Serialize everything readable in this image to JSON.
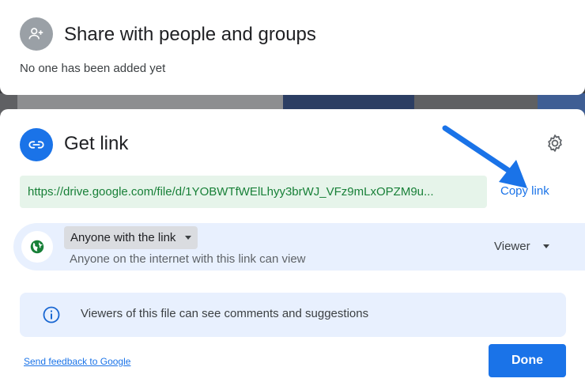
{
  "share": {
    "title": "Share with people and groups",
    "subtitle": "No one has been added yet",
    "icon": "person-add-icon"
  },
  "link": {
    "title": "Get link",
    "icon": "link-icon",
    "settings_icon": "gear-icon",
    "url": "https://drive.google.com/file/d/1YOBWTfWElLhyy3brWJ_VFz9mLxOPZM9u...",
    "copy_label": "Copy link",
    "annotation": "arrow-pointer-icon"
  },
  "access": {
    "icon": "globe-icon",
    "scope_label": "Anyone with the link",
    "description": "Anyone on the internet with this link can view",
    "role_label": "Viewer"
  },
  "info": {
    "icon": "info-icon",
    "text": "Viewers of this file can see comments and suggestions"
  },
  "footer": {
    "feedback_label": "Send feedback to Google",
    "done_label": "Done"
  },
  "colors": {
    "accent": "#1a73e8",
    "url_bg": "#e6f4ea",
    "url_text": "#188038",
    "panel_bg": "#e8f0fe",
    "annotation_arrow": "#1a73e8"
  }
}
